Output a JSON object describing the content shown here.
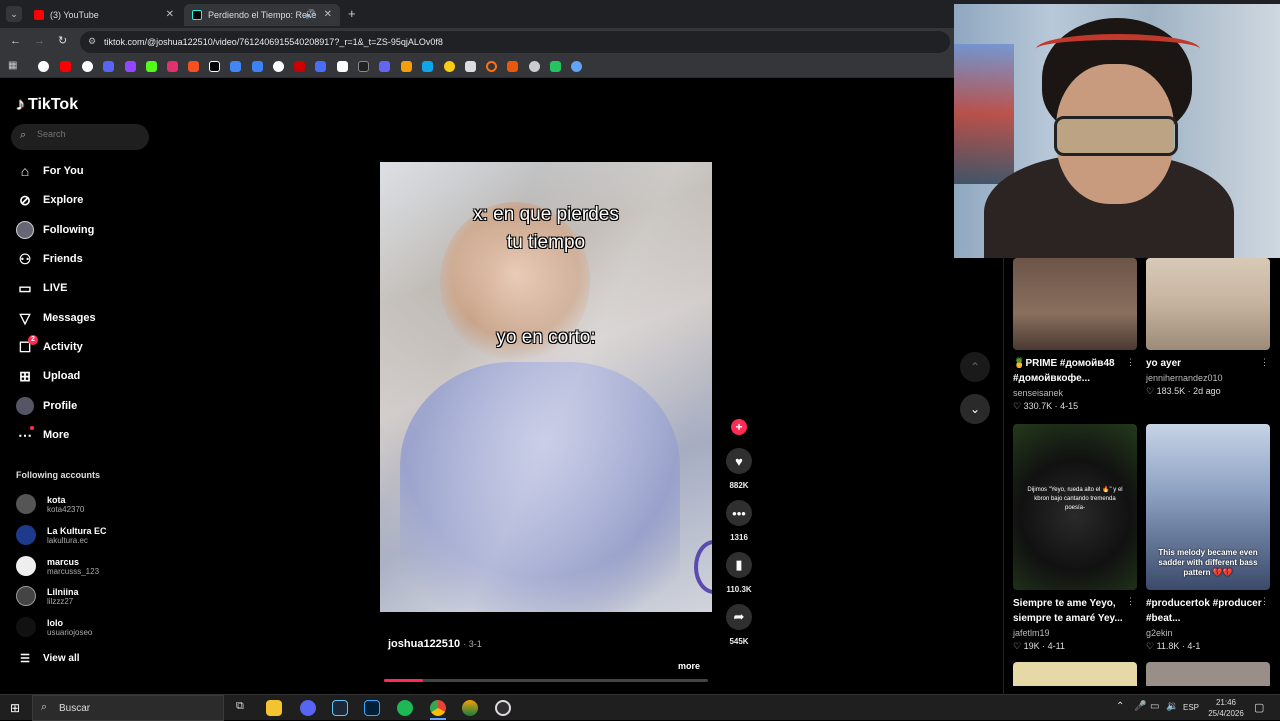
{
  "browser": {
    "tabs": [
      {
        "label": "(3) YouTube",
        "active": false
      },
      {
        "label": "Perdiendo el Tiempo: Refle",
        "active": true
      }
    ],
    "url": "tiktok.com/@joshua122510/video/7612406915540208917?_r=1&_t=ZS-95qjALOv0f8"
  },
  "tiktok": {
    "logo": "TikTok",
    "search_placeholder": "Search",
    "nav": [
      {
        "label": "For You",
        "icon": "home-icon"
      },
      {
        "label": "Explore",
        "icon": "compass-icon"
      },
      {
        "label": "Following",
        "icon": "following-avatar-icon"
      },
      {
        "label": "Friends",
        "icon": "friends-icon"
      },
      {
        "label": "LIVE",
        "icon": "live-icon"
      },
      {
        "label": "Messages",
        "icon": "messages-icon"
      },
      {
        "label": "Activity",
        "icon": "activity-icon"
      },
      {
        "label": "Upload",
        "icon": "upload-icon"
      },
      {
        "label": "Profile",
        "icon": "profile-icon"
      },
      {
        "label": "More",
        "icon": "more-icon"
      }
    ],
    "activity_badge": "2",
    "following_heading": "Following accounts",
    "accounts": [
      {
        "name": "kota",
        "handle": "kota42370",
        "color": "#555"
      },
      {
        "name": "La Kultura EC",
        "handle": "lakultura.ec",
        "color": "#1e3a8a"
      },
      {
        "name": "marcus",
        "handle": "marcusss_123",
        "color": "#eee"
      },
      {
        "name": "Lilniina",
        "handle": "lilzzz27",
        "color": "#444"
      },
      {
        "name": "lolo",
        "handle": "usuariojoseo",
        "color": "#111"
      }
    ],
    "view_all": "View all"
  },
  "video": {
    "caption_top_1": "x: en que pierdes",
    "caption_top_2": "tu tiempo",
    "caption_mid": "yo en corto:",
    "author": "joshua122510",
    "date": "· 3-1",
    "more": "more",
    "progress": 0.12,
    "likes": "882K",
    "comments": "1316",
    "saves": "110.3K",
    "shares": "545K"
  },
  "feed": [
    {
      "title": "🍍PRIME #домойв48 #домойвкофе...",
      "author": "senseisanek",
      "meta": "♡ 330.7K · 4-15"
    },
    {
      "title": "yo ayer",
      "author": "jennihernandez010",
      "meta": "♡ 183.5K · 2d ago"
    },
    {
      "title": "Siempre te ame Yeyo, siempre te amaré Yey...",
      "author": "jafetlm19",
      "meta": "♡ 19K · 4-11",
      "overlay": "Dijimos \"Yeyo, rueda alto el 🔥\" y el kbron bajo cantando tremenda poesía-"
    },
    {
      "title": "#producertok #producer #beat...",
      "author": "g2ekin",
      "meta": "♡ 11.8K · 4-1",
      "overlay": "This melody became even sadder with different bass pattern 💔💔"
    }
  ],
  "taskbar": {
    "search": "Buscar",
    "lang": "ESP",
    "time": "21:46",
    "date": "25/4/2026"
  },
  "colors": {
    "accent": "#fe2c55",
    "youtube_red": "#ff0000"
  }
}
